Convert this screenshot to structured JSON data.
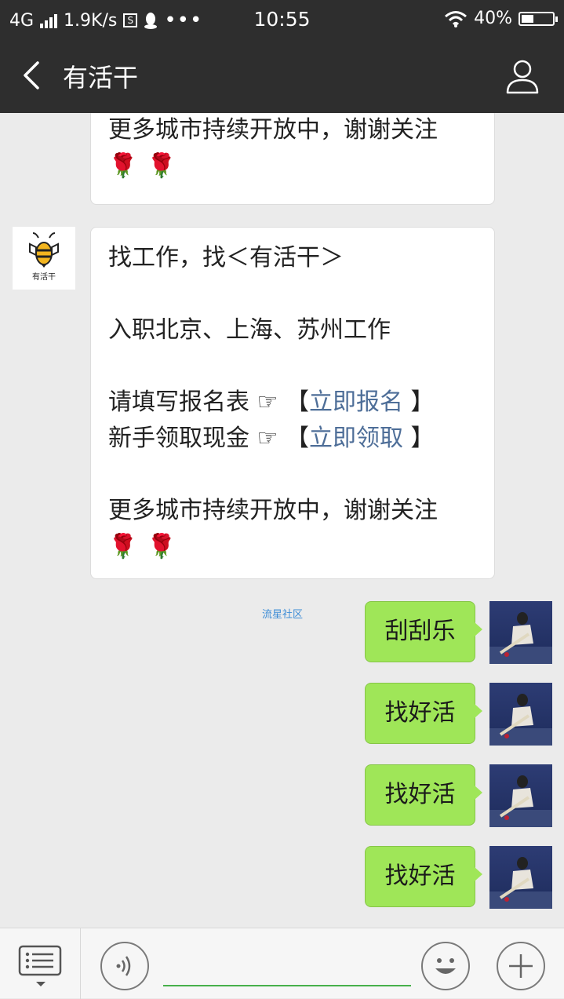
{
  "status": {
    "network": "4G",
    "speed": "1.9K/s",
    "sb_icon": "S",
    "time": "10:55",
    "battery": "40%",
    "battery_level": 0.4
  },
  "header": {
    "title": "有活干"
  },
  "messages": {
    "first": {
      "line": "更多城市持续开放中，谢谢关注",
      "emoji": [
        "🌹",
        "🌹"
      ]
    },
    "second": {
      "logo_text": "有活干",
      "line1": "找工作，找＜有活干＞",
      "line2": "入职北京、上海、苏州工作",
      "signup_text": "请填写报名表 ☞ ",
      "signup_open": "【",
      "signup_link": "立即报名",
      "signup_close": " 】",
      "cash_text": "新手领取现金 ☞ ",
      "cash_open": "【",
      "cash_link": "立即领取",
      "cash_close": " 】",
      "line5": "更多城市持续开放中，谢谢关注",
      "emoji": [
        "🌹",
        "🌹"
      ]
    },
    "sent": [
      "刮刮乐",
      "找好活",
      "找好活",
      "找好活"
    ]
  },
  "watermark": "流星社区",
  "input": {
    "value": ""
  },
  "colors": {
    "header_bg": "#2e2e2e",
    "sent_bubble": "#9fe658",
    "link": "#4e6e98",
    "input_underline": "#47b04b"
  }
}
